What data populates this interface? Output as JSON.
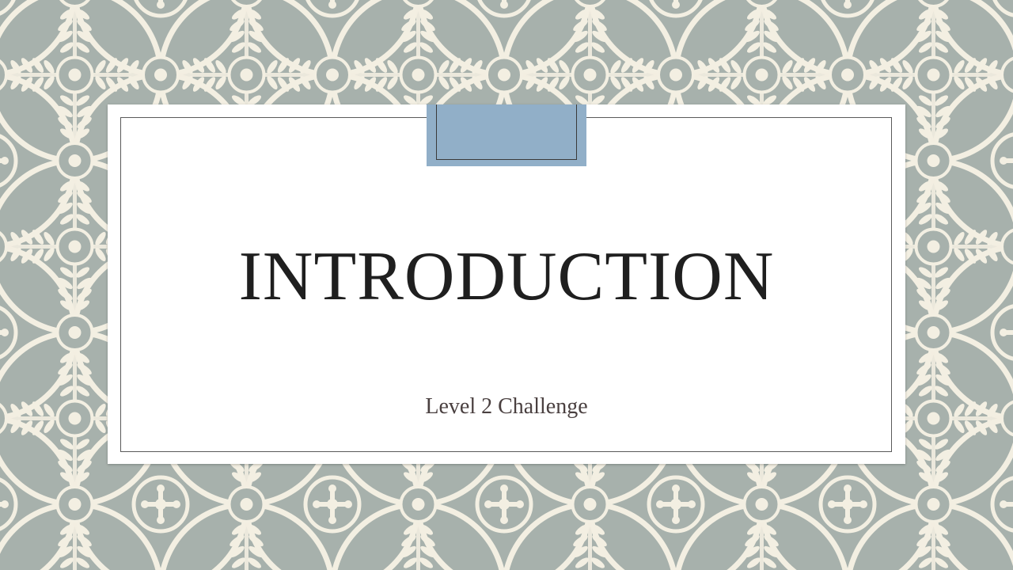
{
  "slide": {
    "title": "INTRODUCTION",
    "subtitle": "Level 2 Challenge"
  },
  "colors": {
    "pattern_background": "#a7b1ac",
    "pattern_ink": "#f3efe2",
    "card_background": "#ffffff",
    "tab_accent": "#91afc8",
    "title_text": "#1f1f1f",
    "subtitle_text": "#4a4040"
  }
}
